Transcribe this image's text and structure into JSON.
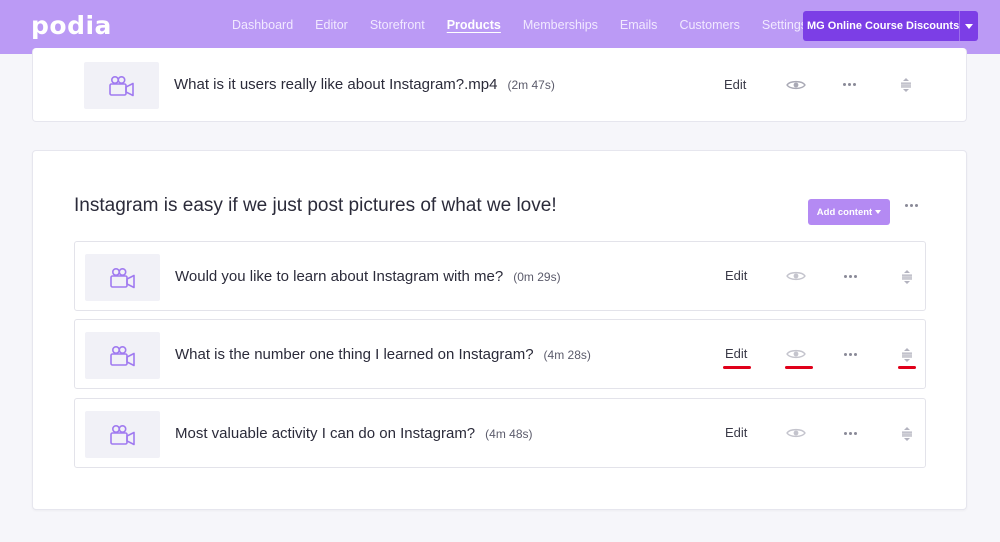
{
  "brand": {
    "logo": "podia",
    "accent": "#bb9af5",
    "button_color": "#7c3ee6"
  },
  "nav": {
    "items": [
      {
        "label": "Dashboard",
        "active": false
      },
      {
        "label": "Editor",
        "active": false
      },
      {
        "label": "Storefront",
        "active": false
      },
      {
        "label": "Products",
        "active": true
      },
      {
        "label": "Memberships",
        "active": false
      },
      {
        "label": "Emails",
        "active": false
      },
      {
        "label": "Customers",
        "active": false
      },
      {
        "label": "Settings",
        "active": false
      }
    ],
    "site_button": "MG Online Course Discounts"
  },
  "previous_section": {
    "lesson": {
      "title": "What is it users really like about Instagram?.mp4",
      "duration": "(2m 47s)",
      "edit": "Edit",
      "icon": "video-camera-icon"
    }
  },
  "section": {
    "title": "Instagram is easy if we just post pictures of what we love!",
    "add_content": "Add content",
    "lessons": [
      {
        "title": "Would you like to learn about Instagram with me?",
        "duration": "(0m 29s)",
        "edit": "Edit",
        "icon": "video-camera-icon"
      },
      {
        "title": "What is the number one thing I learned on Instagram?",
        "duration": "(4m 28s)",
        "edit": "Edit",
        "icon": "video-camera-icon"
      },
      {
        "title": "Most valuable activity I can do on Instagram?",
        "duration": "(4m 48s)",
        "edit": "Edit",
        "icon": "video-camera-icon"
      }
    ]
  },
  "annotation_color": "#e0001a"
}
